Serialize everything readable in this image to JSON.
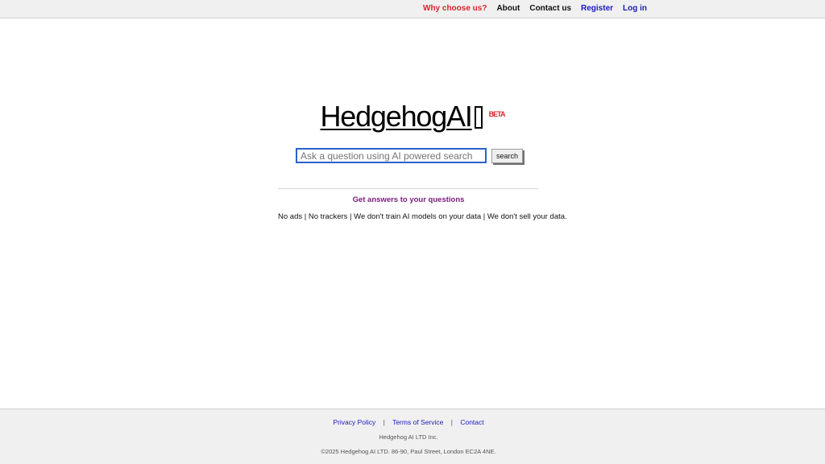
{
  "topnav": {
    "why": "Why choose us?",
    "about": "About",
    "contact": "Contact us",
    "register": "Register",
    "login": "Log in"
  },
  "logo": {
    "text": "HedgehogAI",
    "badge": "BETA"
  },
  "search": {
    "placeholder": "Ask a question using AI powered search",
    "value": "",
    "button_label": "search"
  },
  "tagline": "Get answers to your questions",
  "features": "No ads | No trackers | We don't train AI models on your data | We don't sell your data.",
  "footer": {
    "links": {
      "privacy": "Privacy Policy",
      "terms": "Terms of Service",
      "contact": "Contact"
    },
    "separator": "|",
    "company": "Hedgehog AI LTD Inc.",
    "copyright": "©2025 Hedgehog AI LTD. 86-90, Paul Street, London EC2A 4NE."
  },
  "colors": {
    "why_link": "#d8262b",
    "nav_link": "#1a1ab8",
    "tagline": "#7a1a7a",
    "beta": "#d8262b",
    "input_border": "#2a62c9"
  }
}
